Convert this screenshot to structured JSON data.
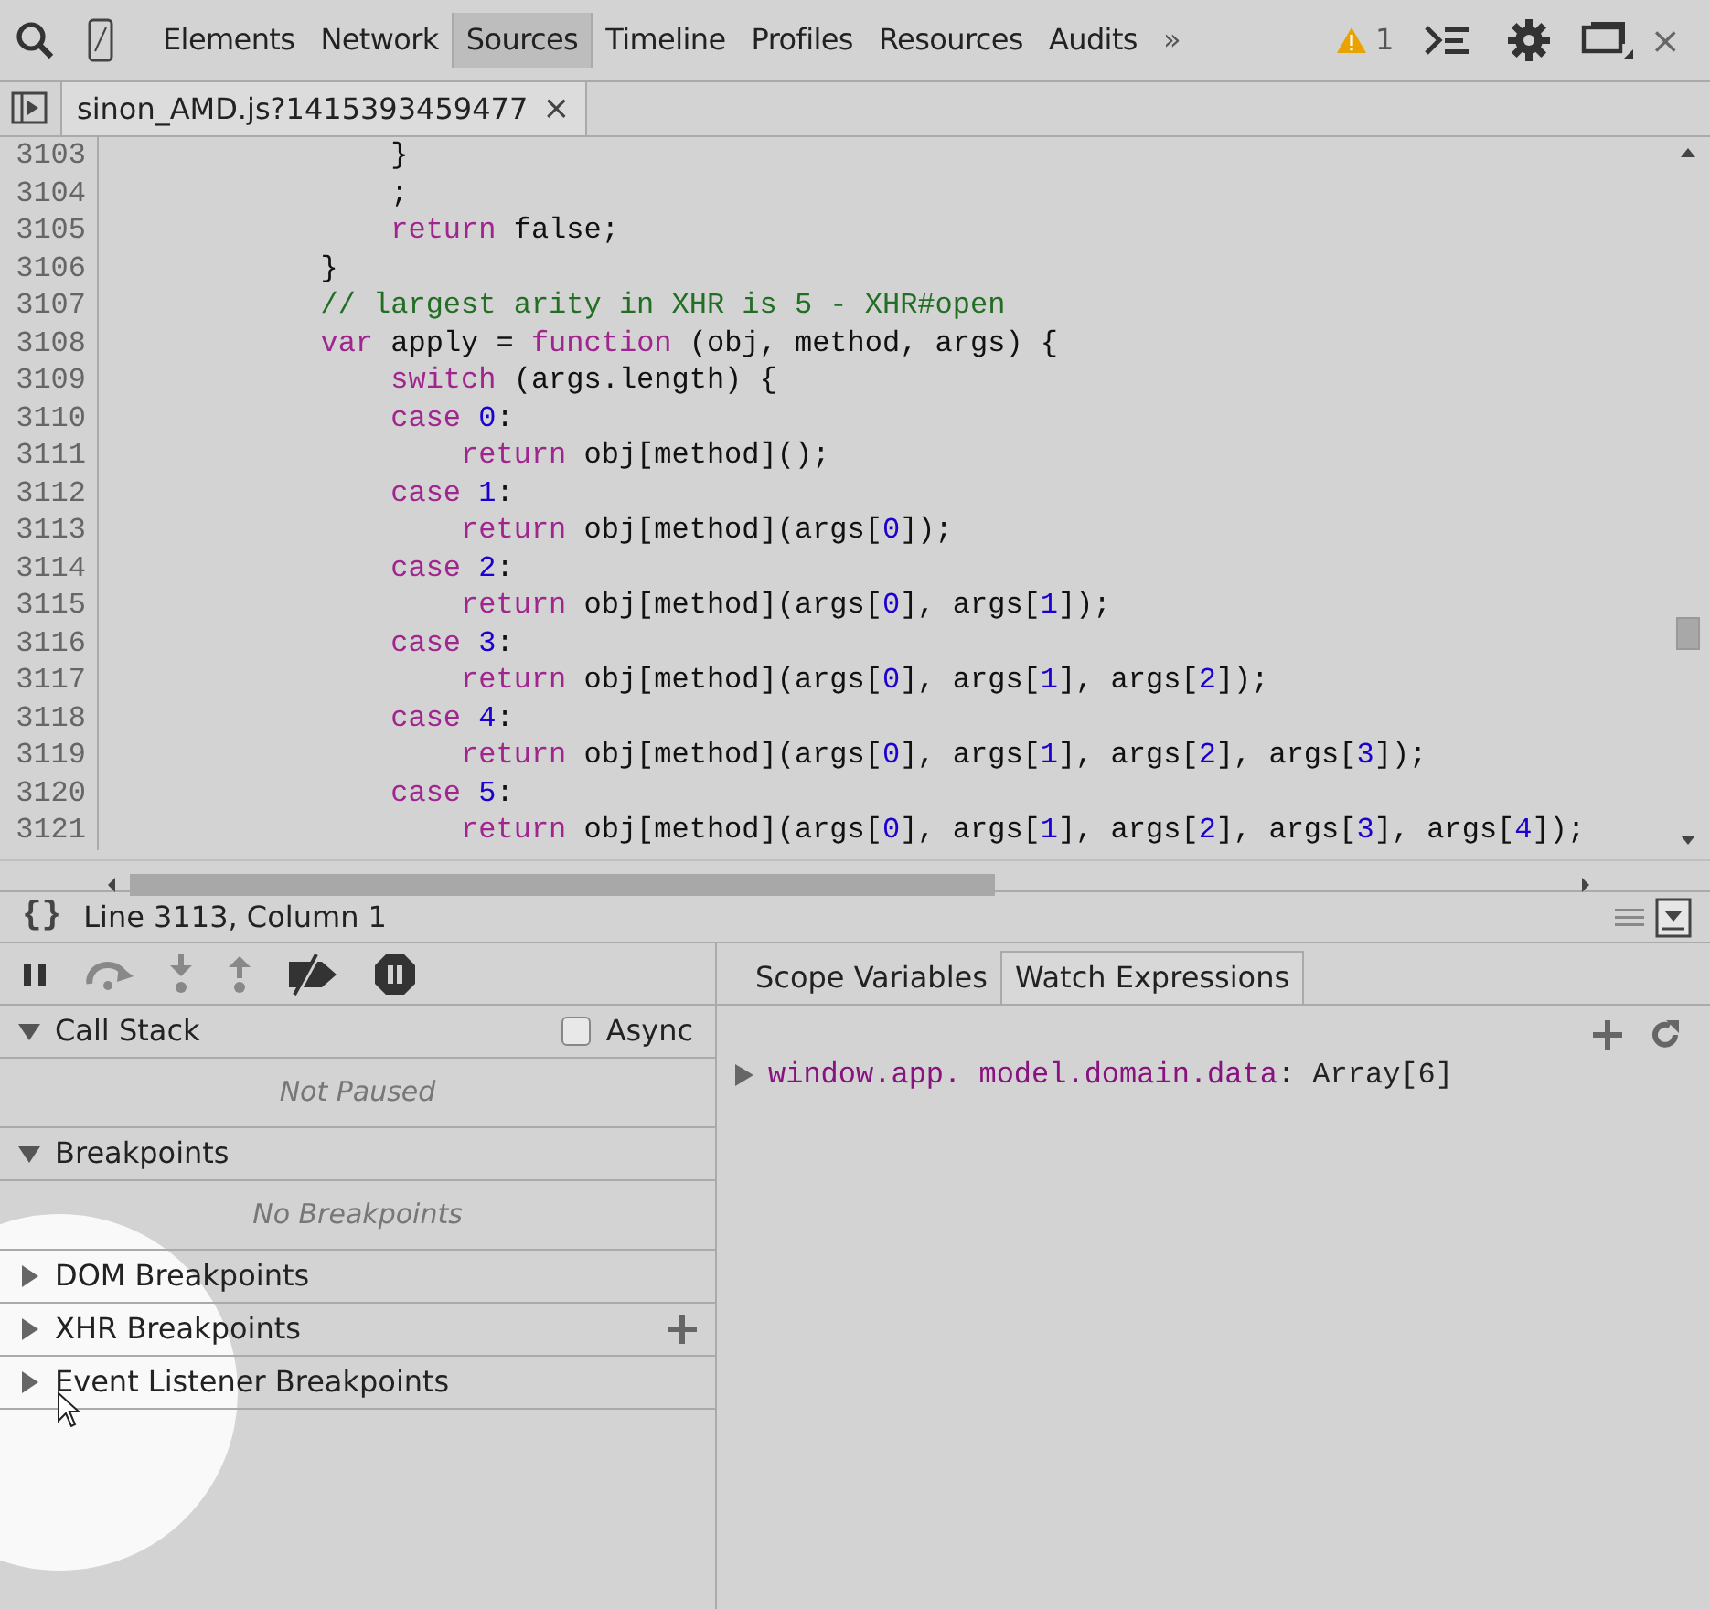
{
  "toolbar": {
    "tabs": [
      {
        "label": "Elements",
        "selected": false
      },
      {
        "label": "Network",
        "selected": false
      },
      {
        "label": "Sources",
        "selected": true
      },
      {
        "label": "Timeline",
        "selected": false
      },
      {
        "label": "Profiles",
        "selected": false
      },
      {
        "label": "Resources",
        "selected": false
      },
      {
        "label": "Audits",
        "selected": false
      }
    ],
    "more": "»",
    "warning_count": "1",
    "close": "×"
  },
  "file_tabs": [
    {
      "label": "sinon_AMD.js?1415393459477",
      "close": "×",
      "selected": true
    }
  ],
  "code": {
    "lines": [
      {
        "number": "3103",
        "tokens": [
          {
            "kind": "plain",
            "text": "                }"
          }
        ]
      },
      {
        "number": "3104",
        "tokens": [
          {
            "kind": "plain",
            "text": "                ;"
          }
        ]
      },
      {
        "number": "3105",
        "tokens": [
          {
            "kind": "keyword",
            "text": "                return"
          },
          {
            "kind": "plain",
            "text": " false;"
          }
        ]
      },
      {
        "number": "3106",
        "tokens": [
          {
            "kind": "plain",
            "text": "            }"
          }
        ]
      },
      {
        "number": "3107",
        "tokens": [
          {
            "kind": "comment",
            "text": "            // largest arity in XHR is 5 - XHR#open"
          }
        ]
      },
      {
        "number": "3108",
        "tokens": [
          {
            "kind": "keyword",
            "text": "            var"
          },
          {
            "kind": "plain",
            "text": " apply = "
          },
          {
            "kind": "keyword",
            "text": "function"
          },
          {
            "kind": "plain",
            "text": " (obj, method, args) {"
          }
        ]
      },
      {
        "number": "3109",
        "tokens": [
          {
            "kind": "keyword",
            "text": "                switch"
          },
          {
            "kind": "plain",
            "text": " (args.length) {"
          }
        ]
      },
      {
        "number": "3110",
        "tokens": [
          {
            "kind": "keyword",
            "text": "                case"
          },
          {
            "kind": "number",
            "text": " 0"
          },
          {
            "kind": "plain",
            "text": ":"
          }
        ]
      },
      {
        "number": "3111",
        "tokens": [
          {
            "kind": "keyword",
            "text": "                    return"
          },
          {
            "kind": "plain",
            "text": " obj[method]();"
          }
        ]
      },
      {
        "number": "3112",
        "tokens": [
          {
            "kind": "keyword",
            "text": "                case"
          },
          {
            "kind": "number",
            "text": " 1"
          },
          {
            "kind": "plain",
            "text": ":"
          }
        ]
      },
      {
        "number": "3113",
        "tokens": [
          {
            "kind": "keyword",
            "text": "                    return"
          },
          {
            "kind": "plain",
            "text": " obj[method](args["
          },
          {
            "kind": "number",
            "text": "0"
          },
          {
            "kind": "plain",
            "text": "]);"
          }
        ]
      },
      {
        "number": "3114",
        "tokens": [
          {
            "kind": "keyword",
            "text": "                case"
          },
          {
            "kind": "number",
            "text": " 2"
          },
          {
            "kind": "plain",
            "text": ":"
          }
        ]
      },
      {
        "number": "3115",
        "tokens": [
          {
            "kind": "keyword",
            "text": "                    return"
          },
          {
            "kind": "plain",
            "text": " obj[method](args["
          },
          {
            "kind": "number",
            "text": "0"
          },
          {
            "kind": "plain",
            "text": "], args["
          },
          {
            "kind": "number",
            "text": "1"
          },
          {
            "kind": "plain",
            "text": "]);"
          }
        ]
      },
      {
        "number": "3116",
        "tokens": [
          {
            "kind": "keyword",
            "text": "                case"
          },
          {
            "kind": "number",
            "text": " 3"
          },
          {
            "kind": "plain",
            "text": ":"
          }
        ]
      },
      {
        "number": "3117",
        "tokens": [
          {
            "kind": "keyword",
            "text": "                    return"
          },
          {
            "kind": "plain",
            "text": " obj[method](args["
          },
          {
            "kind": "number",
            "text": "0"
          },
          {
            "kind": "plain",
            "text": "], args["
          },
          {
            "kind": "number",
            "text": "1"
          },
          {
            "kind": "plain",
            "text": "], args["
          },
          {
            "kind": "number",
            "text": "2"
          },
          {
            "kind": "plain",
            "text": "]);"
          }
        ]
      },
      {
        "number": "3118",
        "tokens": [
          {
            "kind": "keyword",
            "text": "                case"
          },
          {
            "kind": "number",
            "text": " 4"
          },
          {
            "kind": "plain",
            "text": ":"
          }
        ]
      },
      {
        "number": "3119",
        "tokens": [
          {
            "kind": "keyword",
            "text": "                    return"
          },
          {
            "kind": "plain",
            "text": " obj[method](args["
          },
          {
            "kind": "number",
            "text": "0"
          },
          {
            "kind": "plain",
            "text": "], args["
          },
          {
            "kind": "number",
            "text": "1"
          },
          {
            "kind": "plain",
            "text": "], args["
          },
          {
            "kind": "number",
            "text": "2"
          },
          {
            "kind": "plain",
            "text": "], args["
          },
          {
            "kind": "number",
            "text": "3"
          },
          {
            "kind": "plain",
            "text": "]);"
          }
        ]
      },
      {
        "number": "3120",
        "tokens": [
          {
            "kind": "keyword",
            "text": "                case"
          },
          {
            "kind": "number",
            "text": " 5"
          },
          {
            "kind": "plain",
            "text": ":"
          }
        ]
      },
      {
        "number": "3121",
        "tokens": [
          {
            "kind": "keyword",
            "text": "                    return"
          },
          {
            "kind": "plain",
            "text": " obj[method](args["
          },
          {
            "kind": "number",
            "text": "0"
          },
          {
            "kind": "plain",
            "text": "], args["
          },
          {
            "kind": "number",
            "text": "1"
          },
          {
            "kind": "plain",
            "text": "], args["
          },
          {
            "kind": "number",
            "text": "2"
          },
          {
            "kind": "plain",
            "text": "], args["
          },
          {
            "kind": "number",
            "text": "3"
          },
          {
            "kind": "plain",
            "text": "], args["
          },
          {
            "kind": "number",
            "text": "4"
          },
          {
            "kind": "plain",
            "text": "]);"
          }
        ]
      }
    ]
  },
  "status_bar": {
    "braces": "{}",
    "position": "Line 3113, Column 1"
  },
  "sections": [
    {
      "title": "Call Stack",
      "expanded": true,
      "async": {
        "label": "Async",
        "checked": false
      },
      "empty_text": "Not Paused"
    },
    {
      "title": "Breakpoints",
      "expanded": true,
      "empty_text": "No Breakpoints"
    },
    {
      "title": "DOM Breakpoints",
      "expanded": false
    },
    {
      "title": "XHR Breakpoints",
      "expanded": false,
      "add": true
    },
    {
      "title": "Event Listener Breakpoints",
      "expanded": false
    }
  ],
  "right_tabs": [
    {
      "label": "Scope Variables",
      "selected": false
    },
    {
      "label": "Watch Expressions",
      "selected": true
    }
  ],
  "watches": [
    {
      "expression": "window.app. model.domain.data",
      "separator": ":",
      "value": "Array[6]",
      "expanded": false
    }
  ]
}
